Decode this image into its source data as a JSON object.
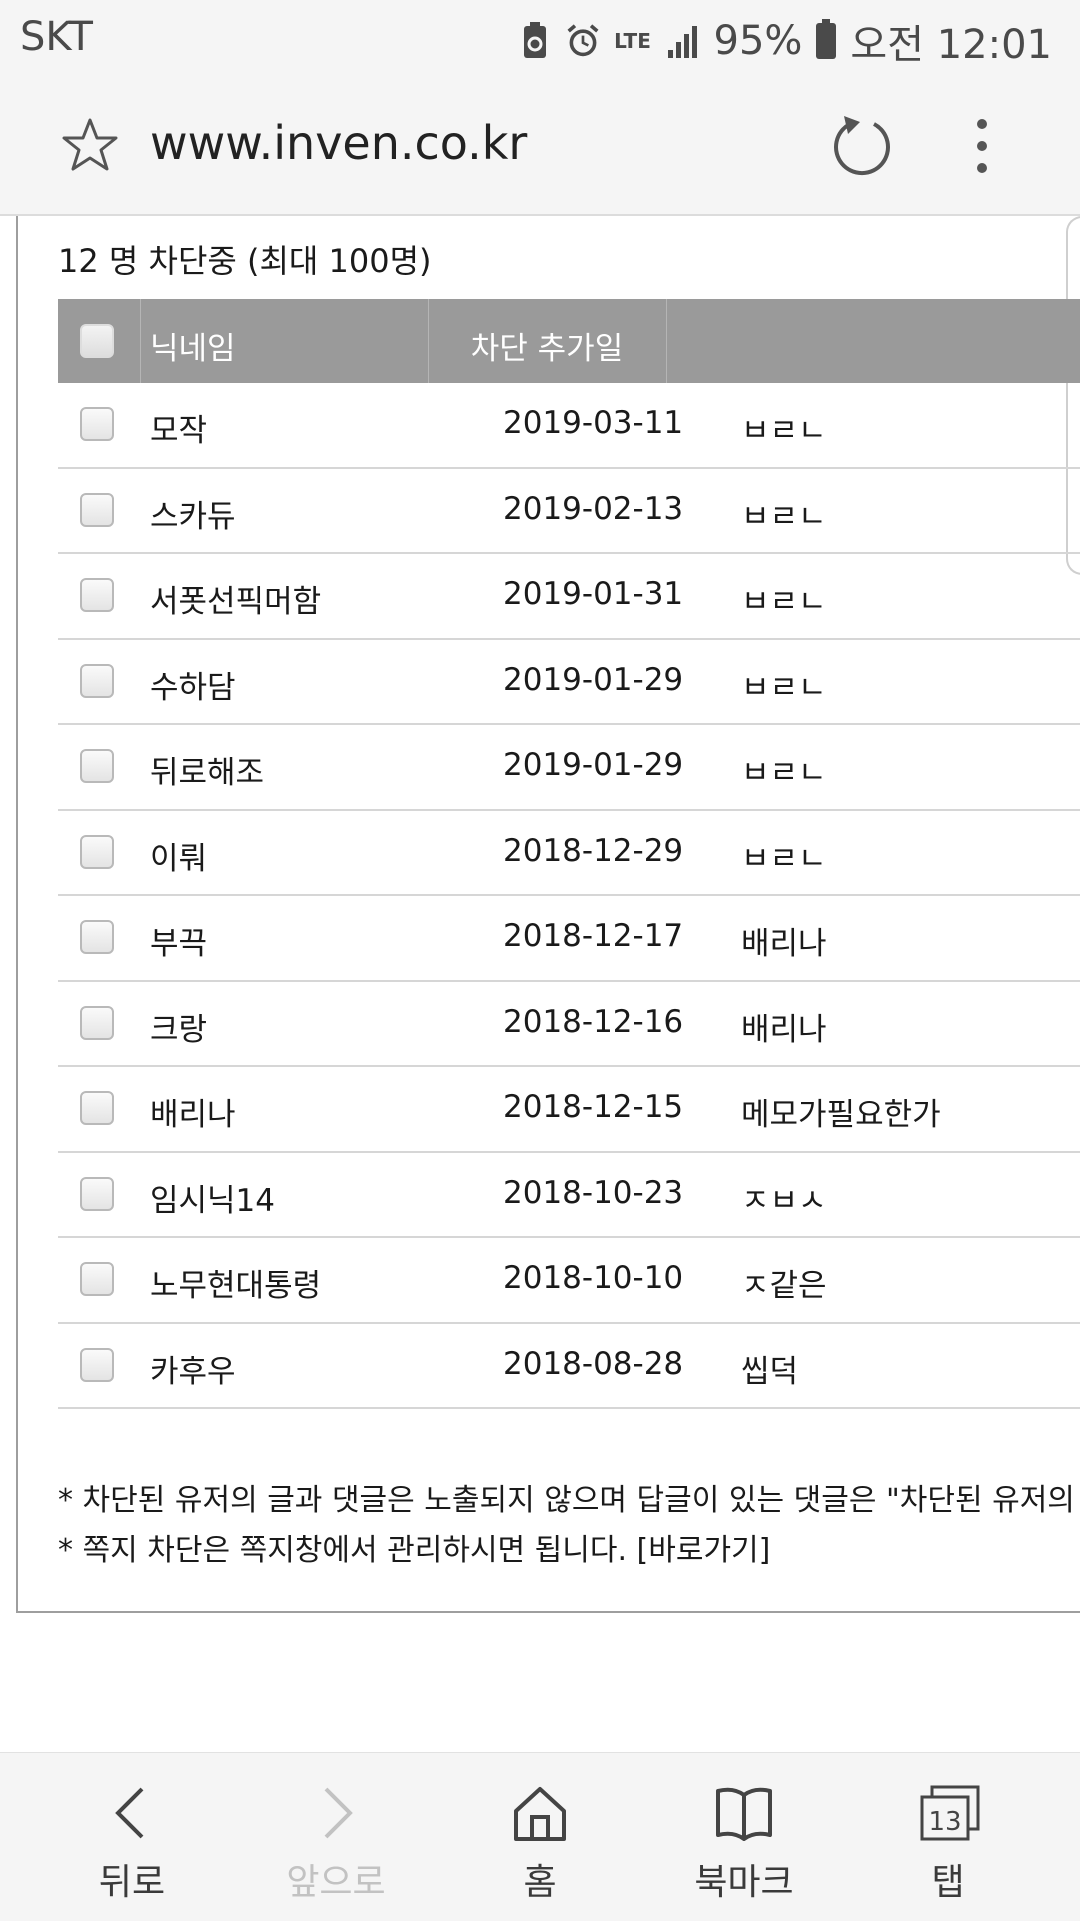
{
  "status_bar": {
    "carrier": "SKT",
    "lte": "LTE",
    "battery": "95%",
    "time": "오전 12:01"
  },
  "url_bar": {
    "url": "www.inven.co.kr"
  },
  "block_list": {
    "count_text": "12 명 차단중 (최대 100명)",
    "headers": {
      "nickname": "닉네임",
      "date_added": "차단 추가일"
    },
    "rows": [
      {
        "nickname": "모작",
        "date": "2019-03-11",
        "memo": "ㅂㄹㄴ"
      },
      {
        "nickname": "스카듀",
        "date": "2019-02-13",
        "memo": "ㅂㄹㄴ"
      },
      {
        "nickname": "서폿선픽머함",
        "date": "2019-01-31",
        "memo": "ㅂㄹㄴ"
      },
      {
        "nickname": "수하담",
        "date": "2019-01-29",
        "memo": "ㅂㄹㄴ"
      },
      {
        "nickname": "뒤로해조",
        "date": "2019-01-29",
        "memo": "ㅂㄹㄴ"
      },
      {
        "nickname": "이뤄",
        "date": "2018-12-29",
        "memo": "ㅂㄹㄴ"
      },
      {
        "nickname": "부끅",
        "date": "2018-12-17",
        "memo": "배리나"
      },
      {
        "nickname": "크랑",
        "date": "2018-12-16",
        "memo": "배리나"
      },
      {
        "nickname": "배리나",
        "date": "2018-12-15",
        "memo": "메모가필요한가"
      },
      {
        "nickname": "임시닉14",
        "date": "2018-10-23",
        "memo": "ㅈㅂㅅ"
      },
      {
        "nickname": "노무현대통령",
        "date": "2018-10-10",
        "memo": "ㅈ같은"
      },
      {
        "nickname": "카후우",
        "date": "2018-08-28",
        "memo": "씹덕"
      }
    ],
    "notes": [
      "* 차단된 유저의 글과 댓글은 노출되지 않으며 답글이 있는 댓글은 \"차단된 유저의",
      "* 쪽지 차단은 쪽지창에서 관리하시면 됩니다. [바로가기]"
    ]
  },
  "bottom_nav": {
    "back": "뒤로",
    "forward": "앞으로",
    "home": "홈",
    "bookmarks": "북마크",
    "tabs": "탭",
    "tab_count": "13"
  }
}
